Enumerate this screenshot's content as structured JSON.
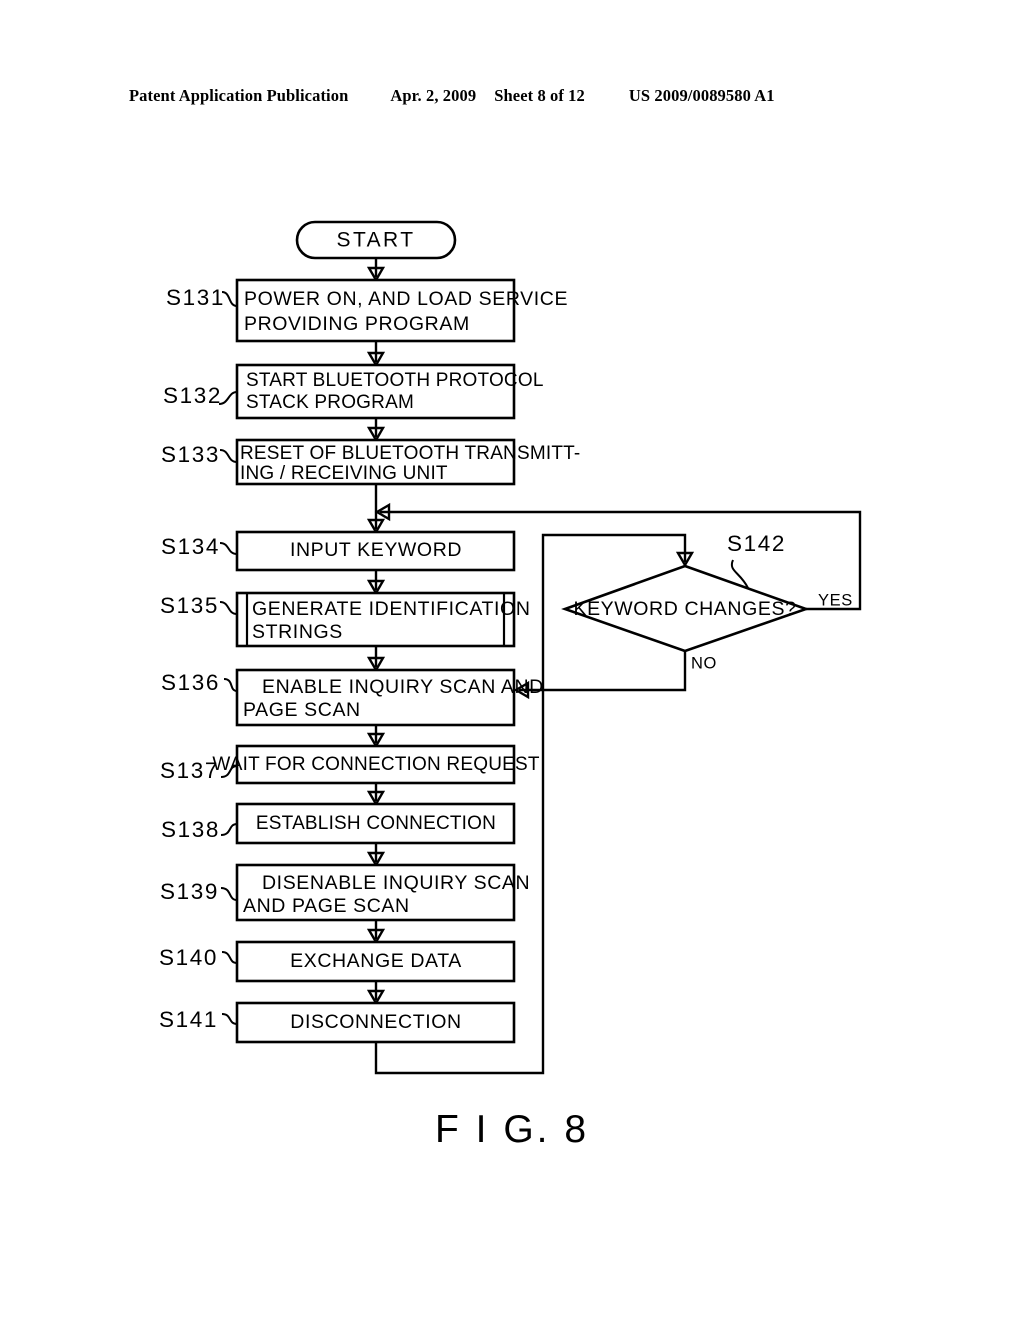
{
  "header": {
    "publication": "Patent Application Publication",
    "date": "Apr. 2, 2009",
    "sheet": "Sheet 8 of 12",
    "patent_number": "US 2009/0089580 A1"
  },
  "figure": {
    "caption": "F I G.  8",
    "terminator": {
      "label": "START"
    },
    "steps": [
      {
        "id": "S131",
        "lines": [
          "POWER ON, AND LOAD SERVICE",
          "PROVIDING PROGRAM"
        ],
        "shape": "process",
        "align": "left"
      },
      {
        "id": "S132",
        "lines": [
          "START BLUETOOTH PROTOCOL",
          "STACK PROGRAM"
        ],
        "shape": "process",
        "align": "left"
      },
      {
        "id": "S133",
        "lines": [
          "RESET OF BLUETOOTH TRANSMITT-",
          "ING / RECEIVING UNIT"
        ],
        "shape": "process",
        "align": "left"
      },
      {
        "id": "S134",
        "lines": [
          "INPUT KEYWORD"
        ],
        "shape": "process",
        "align": "center"
      },
      {
        "id": "S135",
        "lines": [
          "GENERATE IDENTIFICATION",
          "STRINGS"
        ],
        "shape": "predefined-process",
        "align": "left"
      },
      {
        "id": "S136",
        "lines": [
          "ENABLE INQUIRY SCAN AND",
          "PAGE SCAN"
        ],
        "shape": "process",
        "align": "left"
      },
      {
        "id": "S137",
        "lines": [
          "WAIT FOR CONNECTION REQUEST"
        ],
        "shape": "process",
        "align": "center"
      },
      {
        "id": "S138",
        "lines": [
          "ESTABLISH CONNECTION"
        ],
        "shape": "process",
        "align": "center"
      },
      {
        "id": "S139",
        "lines": [
          "DISENABLE INQUIRY SCAN",
          "AND PAGE SCAN"
        ],
        "shape": "process",
        "align": "left"
      },
      {
        "id": "S140",
        "lines": [
          "EXCHANGE DATA"
        ],
        "shape": "process",
        "align": "center"
      },
      {
        "id": "S141",
        "lines": [
          "DISCONNECTION"
        ],
        "shape": "process",
        "align": "center"
      }
    ],
    "decision": {
      "id": "S142",
      "label": "KEYWORD CHANGES?",
      "branch_yes": "YES",
      "branch_no": "NO"
    }
  }
}
